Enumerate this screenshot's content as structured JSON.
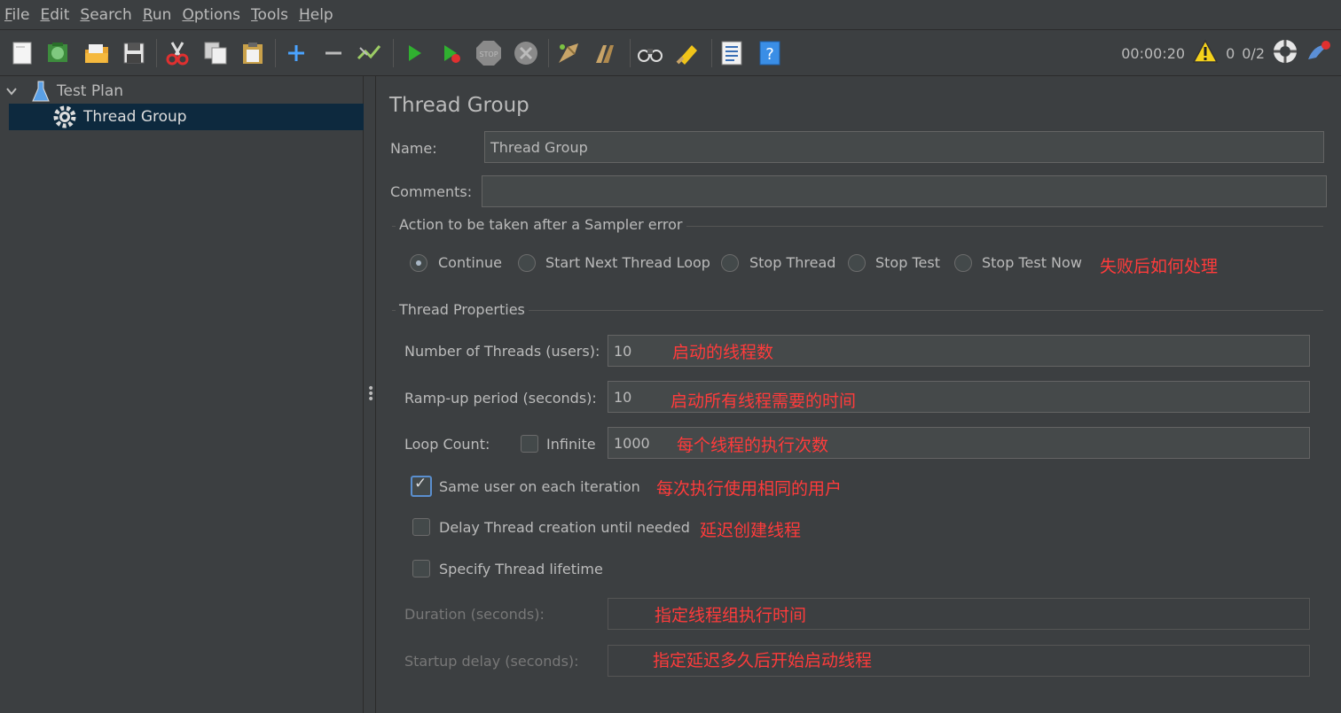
{
  "menu": [
    {
      "u": "F",
      "rest": "ile"
    },
    {
      "u": "E",
      "rest": "dit"
    },
    {
      "u": "S",
      "rest": "earch"
    },
    {
      "u": "R",
      "rest": "un"
    },
    {
      "u": "O",
      "rest": "ptions"
    },
    {
      "u": "T",
      "rest": "ools"
    },
    {
      "u": "H",
      "rest": "elp"
    }
  ],
  "toolbar": {
    "timer": "00:00:20",
    "warnings": "0",
    "threads": "0/2"
  },
  "tree": {
    "root": "Test Plan",
    "child": "Thread Group"
  },
  "panel": {
    "title": "Thread Group",
    "name_label": "Name:",
    "name_value": "Thread Group",
    "comments_label": "Comments:",
    "comments_value": "",
    "error_group": "Action to be taken after a Sampler error",
    "error_options": [
      "Continue",
      "Start Next Thread Loop",
      "Stop Thread",
      "Stop Test",
      "Stop Test Now"
    ],
    "error_note": "失败后如何处理",
    "props_group": "Thread Properties",
    "threads_label": "Number of Threads (users):",
    "threads_value": "10",
    "threads_note": "启动的线程数",
    "rampup_label": "Ramp-up period (seconds):",
    "rampup_value": "10",
    "rampup_note": "启动所有线程需要的时间",
    "loop_label": "Loop Count:",
    "infinite_label": "Infinite",
    "loop_value": "1000",
    "loop_note": "每个线程的执行次数",
    "same_user_label": "Same user on each iteration",
    "same_user_note": "每次执行使用相同的用户",
    "delay_label": "Delay Thread creation until needed",
    "delay_note": "延迟创建线程",
    "lifetime_label": "Specify Thread lifetime",
    "duration_label": "Duration (seconds):",
    "duration_note": "指定线程组执行时间",
    "startup_label": "Startup delay (seconds):",
    "startup_note": "指定延迟多久后开始启动线程"
  }
}
